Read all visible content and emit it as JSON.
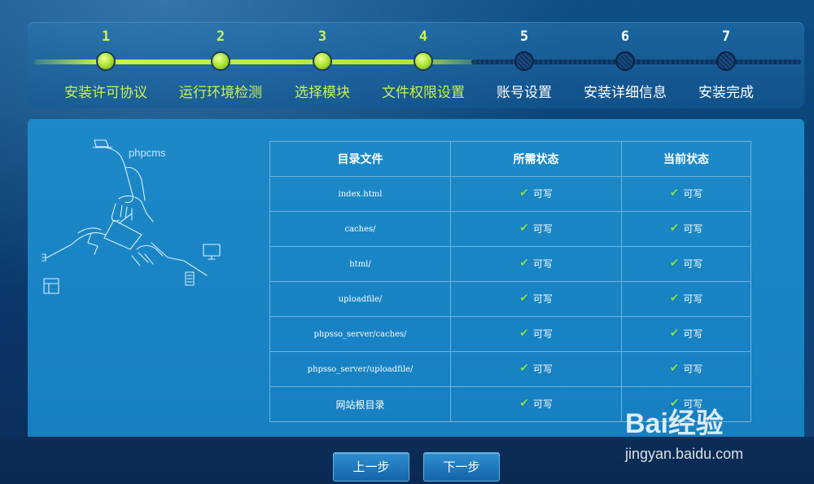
{
  "steps": [
    {
      "num": "1",
      "label": "安装许可协议",
      "state": "done"
    },
    {
      "num": "2",
      "label": "运行环境检测",
      "state": "done"
    },
    {
      "num": "3",
      "label": "选择模块",
      "state": "done"
    },
    {
      "num": "4",
      "label": "文件权限设置",
      "state": "done"
    },
    {
      "num": "5",
      "label": "账号设置",
      "state": "todo"
    },
    {
      "num": "6",
      "label": "安装详细信息",
      "state": "todo"
    },
    {
      "num": "7",
      "label": "安装完成",
      "state": "todo"
    }
  ],
  "brand": {
    "text": "phpcms"
  },
  "table": {
    "headers": [
      "目录文件",
      "所需状态",
      "当前状态"
    ],
    "rows": [
      {
        "path": "index.html",
        "required": "可写",
        "current": "可写"
      },
      {
        "path": "caches/",
        "required": "可写",
        "current": "可写"
      },
      {
        "path": "html/",
        "required": "可写",
        "current": "可写"
      },
      {
        "path": "uploadfile/",
        "required": "可写",
        "current": "可写"
      },
      {
        "path": "phpsso_server/caches/",
        "required": "可写",
        "current": "可写"
      },
      {
        "path": "phpsso_server/uploadfile/",
        "required": "可写",
        "current": "可写"
      },
      {
        "path": "网站根目录",
        "required": "可写",
        "current": "可写"
      }
    ]
  },
  "buttons": {
    "prev": "上一步",
    "next": "下一步"
  },
  "watermark": {
    "logo": "Bai经验",
    "url": "jingyan.baidu.com"
  },
  "colors": {
    "done": "#c6f05a",
    "todo": "#ffffff",
    "check": "#7fe55a"
  }
}
